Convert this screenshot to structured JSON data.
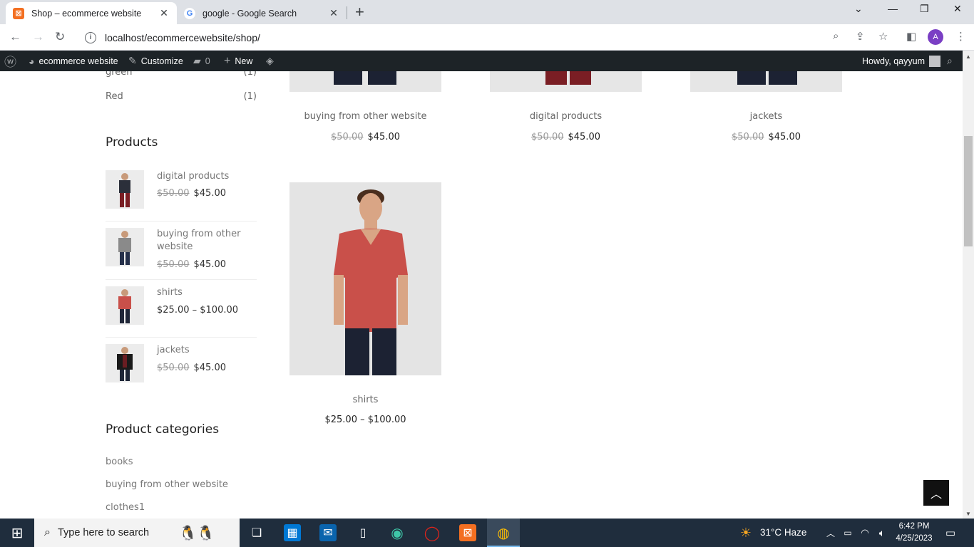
{
  "browser": {
    "tabs": [
      {
        "title": "Shop – ecommerce website",
        "favicon": "xampp-icon",
        "active": true
      },
      {
        "title": "google - Google Search",
        "favicon": "google-icon",
        "active": false
      }
    ],
    "url": "localhost/ecommercewebsite/shop/",
    "profile_initial": "A"
  },
  "adminbar": {
    "site_name": "ecommerce website",
    "customize": "Customize",
    "comments_count": "0",
    "new_label": "New",
    "howdy": "Howdy, qayyum"
  },
  "sidebar": {
    "color_filters": [
      {
        "name": "green",
        "count": "(1)"
      },
      {
        "name": "Red",
        "count": "(1)"
      }
    ],
    "products_title": "Products",
    "products": [
      {
        "name": "digital products",
        "old_price": "$50.00",
        "price": "$45.00"
      },
      {
        "name": "buying from other website",
        "old_price": "$50.00",
        "price": "$45.00"
      },
      {
        "name": "shirts",
        "old_price": "",
        "price": "$25.00 – $100.00"
      },
      {
        "name": "jackets",
        "old_price": "$50.00",
        "price": "$45.00"
      }
    ],
    "categories_title": "Product categories",
    "categories": [
      "books",
      "buying from other website",
      "clothes1"
    ]
  },
  "products": [
    {
      "name": "buying from other website",
      "old_price": "$50.00",
      "price": "$45.00"
    },
    {
      "name": "digital products",
      "old_price": "$50.00",
      "price": "$45.00"
    },
    {
      "name": "jackets",
      "old_price": "$50.00",
      "price": "$45.00"
    },
    {
      "name": "shirts",
      "old_price": "",
      "price": "$25.00 – $100.00"
    }
  ],
  "taskbar": {
    "search_placeholder": "Type here to search",
    "weather": "31°C  Haze",
    "time": "6:42 PM",
    "date": "4/25/2023"
  },
  "colors": {
    "admin_bar": "#1d2327",
    "taskbar": "#1f2d3d",
    "shirt_red": "#c9504a"
  }
}
